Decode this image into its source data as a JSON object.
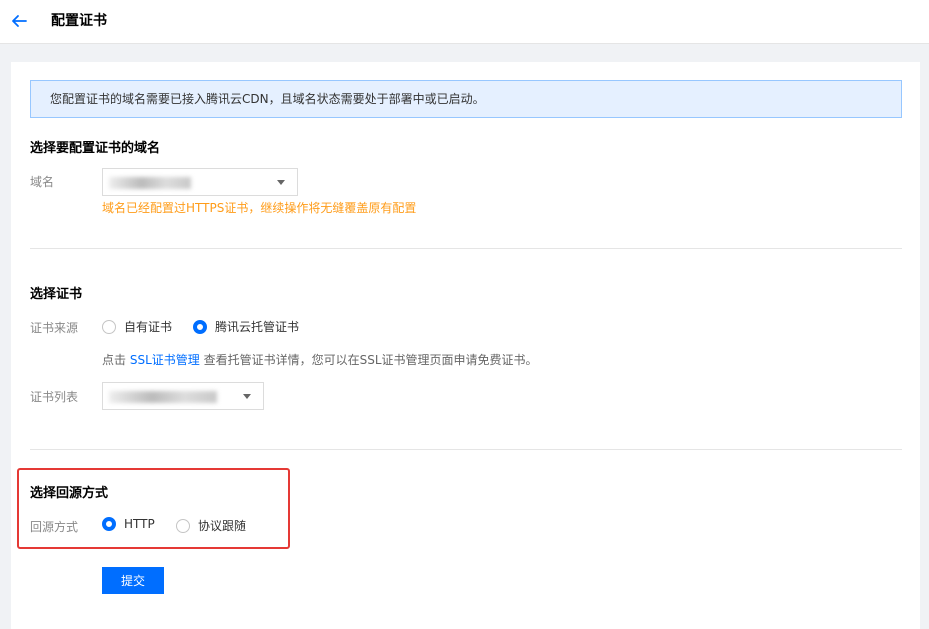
{
  "header": {
    "back_icon": "arrow-left-icon",
    "title": "配置证书"
  },
  "notice": {
    "text": "您配置证书的域名需要已接入腾讯云CDN，且域名状态需要处于部署中或已启动。"
  },
  "domain_section": {
    "title": "选择要配置证书的域名",
    "label": "域名",
    "select_value": "",
    "warning": "域名已经配置过HTTPS证书，继续操作将无缝覆盖原有配置"
  },
  "cert_section": {
    "title": "选择证书",
    "source_label": "证书来源",
    "source_options": [
      {
        "label": "自有证书",
        "checked": false
      },
      {
        "label": "腾讯云托管证书",
        "checked": true
      }
    ],
    "hint_prefix": "点击",
    "hint_link": "SSL证书管理",
    "hint_suffix": "查看托管证书详情，您可以在SSL证书管理页面申请免费证书。",
    "list_label": "证书列表",
    "list_value": ""
  },
  "origin_section": {
    "title": "选择回源方式",
    "label": "回源方式",
    "options": [
      {
        "label": "HTTP",
        "checked": true
      },
      {
        "label": "协议跟随",
        "checked": false
      }
    ]
  },
  "actions": {
    "submit_label": "提交"
  },
  "colors": {
    "accent": "#006eff",
    "warning": "#ff9c19",
    "highlight": "#e53935"
  }
}
